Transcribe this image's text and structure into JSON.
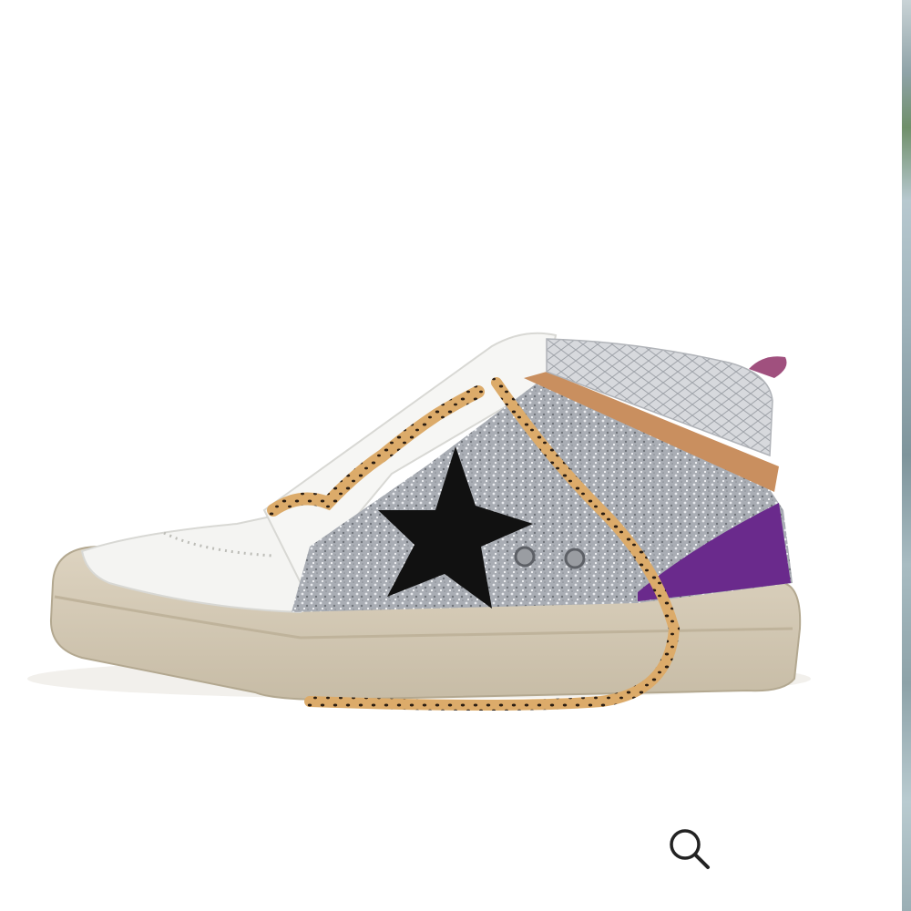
{
  "gallery": {
    "main_image": {
      "alt": "",
      "icon": "sneaker-product-image"
    },
    "zoom": {
      "icon": "magnifier-icon",
      "label": ""
    },
    "next_slide": {
      "icon": "next-image-preview"
    }
  },
  "colors": {
    "background": "#ffffff",
    "sole": "#d6ccb8",
    "glitter": "#b9bcc2",
    "star": "#111111",
    "purple_suede": "#6a2a8c",
    "tan_stripe": "#c98f5f",
    "leopard": "#d9a15b",
    "heel_tab": "#a0507e",
    "icon": "#222222"
  }
}
